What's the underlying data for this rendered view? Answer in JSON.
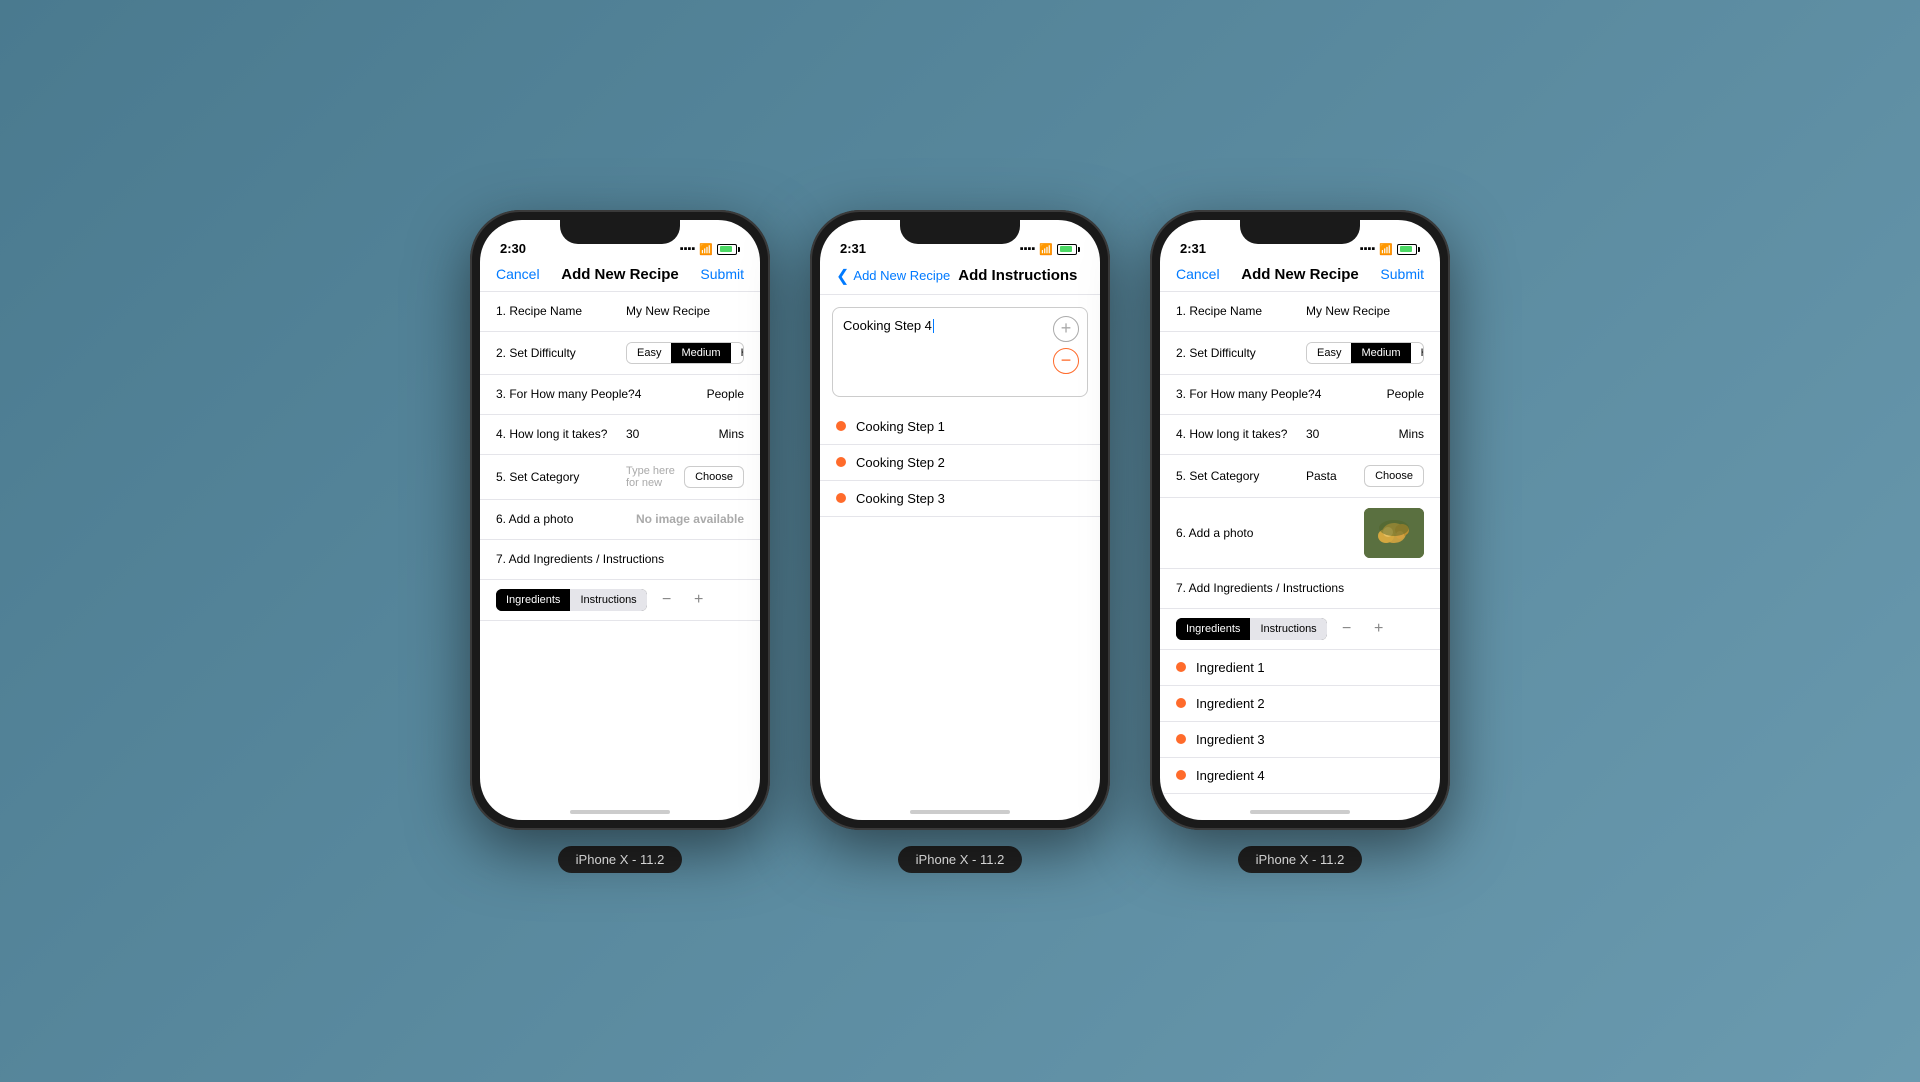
{
  "phones": [
    {
      "id": "phone1",
      "label": "iPhone X - 11.2",
      "status": {
        "time": "2:30",
        "signal": "····",
        "wifi": "wifi",
        "battery": "green"
      },
      "nav": {
        "cancel": "Cancel",
        "title": "Add New Recipe",
        "submit": "Submit"
      },
      "form": {
        "fields": [
          {
            "label": "1. Recipe Name",
            "value": "My New Recipe",
            "type": "text"
          },
          {
            "label": "2. Set Difficulty",
            "type": "difficulty",
            "options": [
              "Easy",
              "Medium",
              "Hard"
            ],
            "active": "Medium"
          },
          {
            "label": "3. For How many People?",
            "value": "4",
            "unit": "People",
            "type": "number"
          },
          {
            "label": "4. How long it takes?",
            "value": "30",
            "unit": "Mins",
            "type": "number"
          },
          {
            "label": "5. Set Category",
            "placeholder": "Type here for new",
            "chooseBtn": "Choose",
            "type": "category"
          },
          {
            "label": "6. Add a photo",
            "noImage": "No image\navailable",
            "type": "photo-none"
          },
          {
            "label": "7. Add Ingredients / Instructions",
            "type": "ingredients-header"
          }
        ],
        "tabs": {
          "tab1": "Ingredients",
          "tab2": "Instructions",
          "activeTab": "tab1"
        },
        "items": []
      }
    },
    {
      "id": "phone2",
      "label": "iPhone X - 11.2",
      "status": {
        "time": "2:31",
        "signal": "····",
        "wifi": "wifi",
        "battery": "green"
      },
      "nav": {
        "back": "Add New Recipe",
        "title": "Add Instructions"
      },
      "textInput": "Cooking Step 4",
      "steps": [
        {
          "text": "Cooking Step 1"
        },
        {
          "text": "Cooking Step 2"
        },
        {
          "text": "Cooking Step 3"
        }
      ]
    },
    {
      "id": "phone3",
      "label": "iPhone X - 11.2",
      "status": {
        "time": "2:31",
        "signal": "····",
        "wifi": "wifi",
        "battery": "green"
      },
      "nav": {
        "cancel": "Cancel",
        "title": "Add New Recipe",
        "submit": "Submit"
      },
      "form": {
        "fields": [
          {
            "label": "1. Recipe Name",
            "value": "My New Recipe",
            "type": "text"
          },
          {
            "label": "2. Set Difficulty",
            "type": "difficulty",
            "options": [
              "Easy",
              "Medium",
              "Hard"
            ],
            "active": "Medium"
          },
          {
            "label": "3. For How many People?",
            "value": "4",
            "unit": "People",
            "type": "number"
          },
          {
            "label": "4. How long it takes?",
            "value": "30",
            "unit": "Mins",
            "type": "number"
          },
          {
            "label": "5. Set Category",
            "value": "Pasta",
            "chooseBtn": "Choose",
            "type": "category-filled"
          },
          {
            "label": "6. Add a photo",
            "type": "photo-filled"
          },
          {
            "label": "7. Add Ingredients / Instructions",
            "type": "ingredients-header"
          }
        ],
        "tabs": {
          "tab1": "Ingredients",
          "tab2": "Instructions",
          "activeTab": "tab1"
        },
        "items": [
          {
            "text": "Ingredient 1"
          },
          {
            "text": "Ingredient 2"
          },
          {
            "text": "Ingredient 3"
          },
          {
            "text": "Ingredient 4"
          }
        ]
      }
    }
  ]
}
